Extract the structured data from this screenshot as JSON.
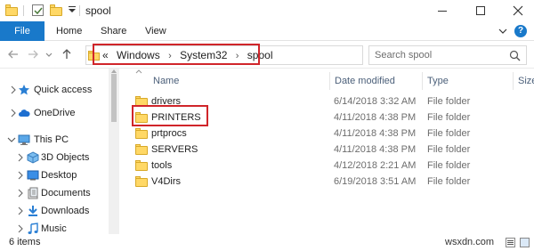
{
  "window": {
    "title": "spool"
  },
  "ribbon": {
    "tabs": [
      {
        "label": "File"
      },
      {
        "label": "Home"
      },
      {
        "label": "Share"
      },
      {
        "label": "View"
      }
    ],
    "help_label": "?"
  },
  "nav": {
    "address": {
      "overflow": "«",
      "crumbs": [
        "Windows",
        "System32",
        "spool"
      ],
      "separator": "›"
    },
    "search": {
      "placeholder": "Search spool"
    }
  },
  "sidebar": {
    "items": [
      {
        "label": "Quick access",
        "icon": "star-icon"
      },
      {
        "label": "OneDrive",
        "icon": "cloud-icon"
      },
      {
        "label": "This PC",
        "icon": "computer-icon"
      },
      {
        "label": "3D Objects",
        "icon": "cube-icon"
      },
      {
        "label": "Desktop",
        "icon": "desktop-icon"
      },
      {
        "label": "Documents",
        "icon": "documents-icon"
      },
      {
        "label": "Downloads",
        "icon": "download-icon"
      },
      {
        "label": "Music",
        "icon": "music-icon"
      }
    ]
  },
  "columns": {
    "name": "Name",
    "date": "Date modified",
    "type": "Type",
    "size": "Size"
  },
  "files": [
    {
      "name": "drivers",
      "date": "6/14/2018 3:32 AM",
      "type": "File folder"
    },
    {
      "name": "PRINTERS",
      "date": "4/11/2018 4:38 PM",
      "type": "File folder"
    },
    {
      "name": "prtprocs",
      "date": "4/11/2018 4:38 PM",
      "type": "File folder"
    },
    {
      "name": "SERVERS",
      "date": "4/11/2018 4:38 PM",
      "type": "File folder"
    },
    {
      "name": "tools",
      "date": "4/12/2018 2:21 AM",
      "type": "File folder"
    },
    {
      "name": "V4Dirs",
      "date": "6/19/2018 3:51 AM",
      "type": "File folder"
    }
  ],
  "status": {
    "item_count": "6 items",
    "watermark": "wsxdn.com"
  },
  "colors": {
    "accent": "#1979ca",
    "highlight": "#d0252a",
    "folder": "#ffd866"
  }
}
